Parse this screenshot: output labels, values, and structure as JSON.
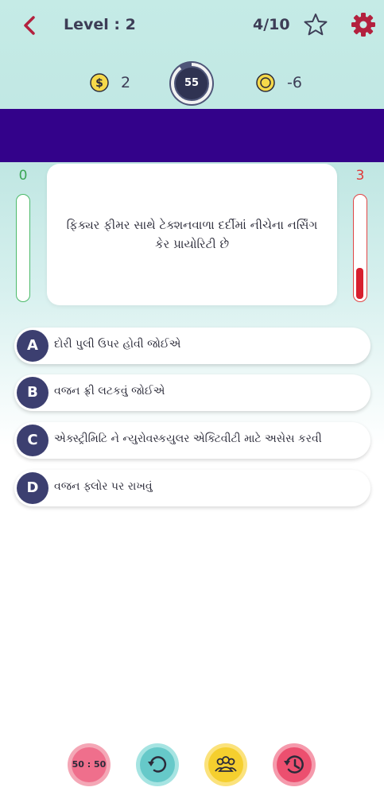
{
  "header": {
    "level_text": "Level : 2",
    "progress_text": "4/10",
    "back_icon": "chevron-left-icon",
    "star_icon": "star-outline-icon",
    "settings_icon": "gear-icon"
  },
  "stats": {
    "money_value": "2",
    "timer_value": "55",
    "timer_progress": 0.9,
    "coin_value": "-6"
  },
  "score": {
    "correct": "0",
    "wrong": "3",
    "wrong_fill_fraction": 0.3
  },
  "question": {
    "text": "ફિક્યર ફીમર સાથે ટેક્શનવાળા દર્દીમાં નીચેના નર્સિંગ કેર પ્રાયોરિટી છે"
  },
  "options": [
    {
      "letter": "A",
      "text": "દોરી પુલી ઉપર હોવી જોઈએ"
    },
    {
      "letter": "B",
      "text": "વજન ફ્રી લટકવું જોઈએ"
    },
    {
      "letter": "C",
      "text": "એક્સ્ટ્રીમિટિ ને ન્યુરોવસ્કયુલર એક્ટિવીટી માટે અસેસ કરવી"
    },
    {
      "letter": "D",
      "text": "વજન ફ્લોર પર રાખવું"
    }
  ],
  "lifelines": {
    "fifty_fifty_label": "50 : 50"
  },
  "colors": {
    "banner": "#33028a",
    "option_letter_bg": "#3c3f70",
    "correct_meter": "#4cba6a",
    "wrong_meter": "#e04545",
    "lifeline_pink": "#f07a92",
    "lifeline_teal": "#7fd6d6",
    "lifeline_yellow": "#f8d548",
    "lifeline_red": "#ef5d78"
  }
}
